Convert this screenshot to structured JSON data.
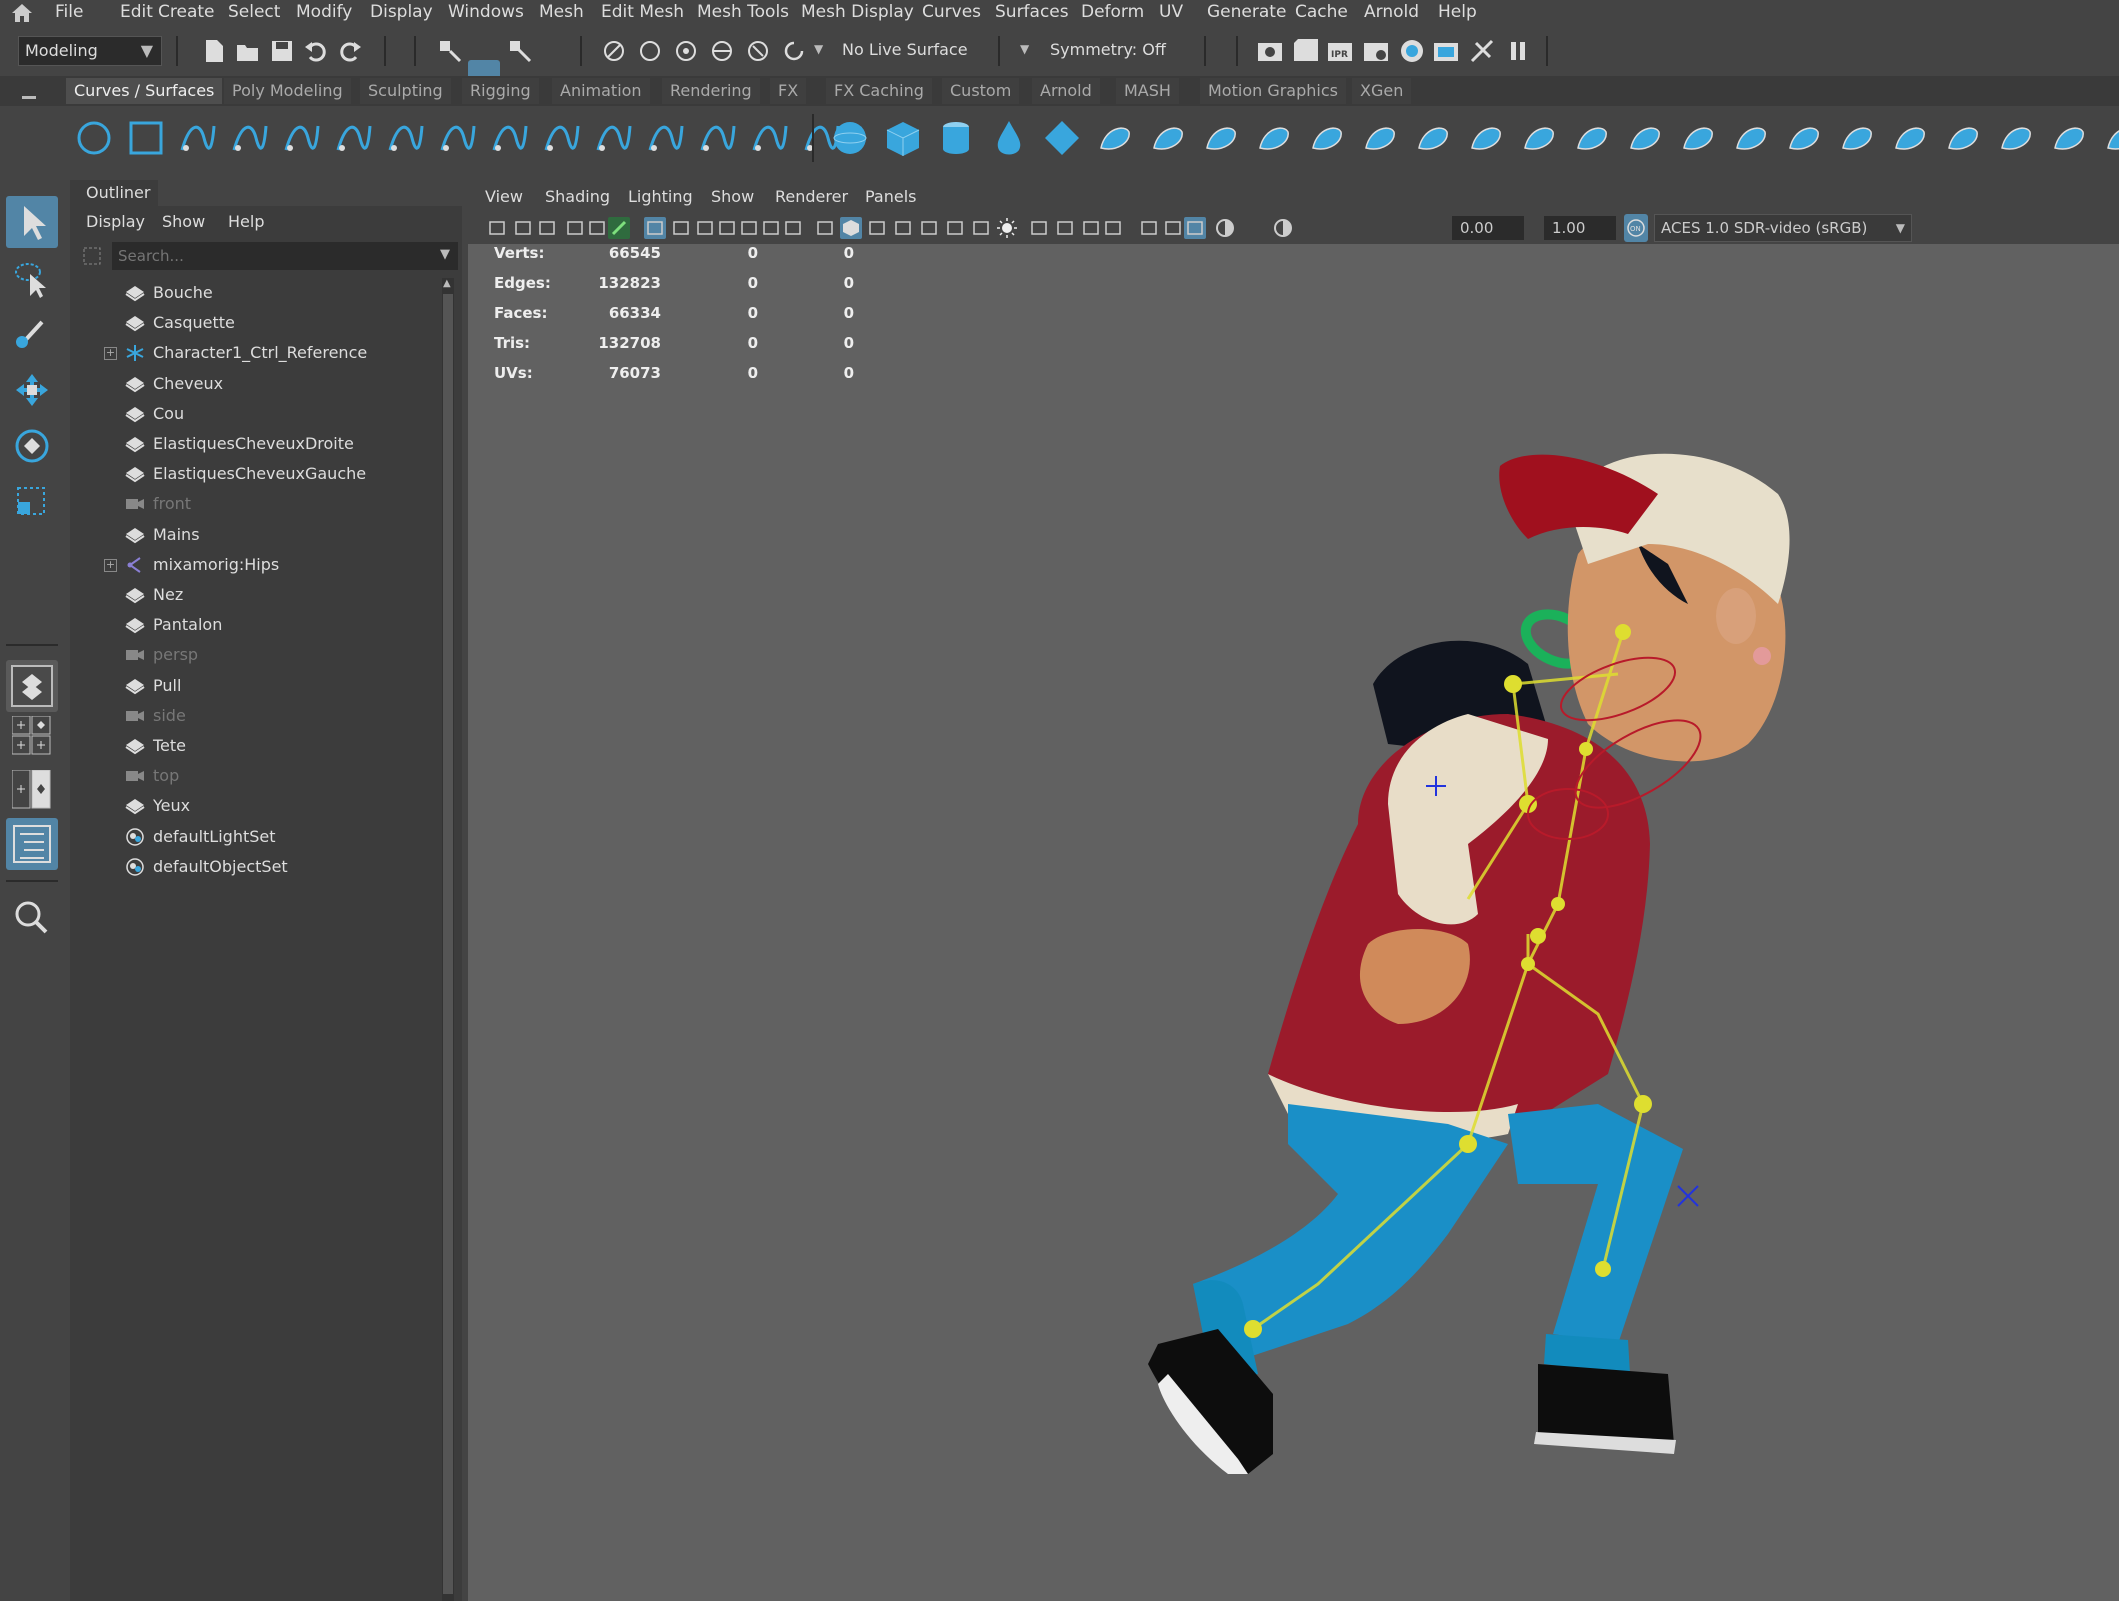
{
  "menu": [
    "File",
    "Edit",
    "Create",
    "Select",
    "Modify",
    "Display",
    "Windows",
    "Mesh",
    "Edit Mesh",
    "Mesh Tools",
    "Mesh Display",
    "Curves",
    "Surfaces",
    "Deform",
    "UV",
    "Generate",
    "Cache",
    "Arnold",
    "Help"
  ],
  "statusline": {
    "mode": "Modeling",
    "live_surface": "No Live Surface",
    "symmetry": "Symmetry: Off"
  },
  "shelf_tabs": [
    "Curves / Surfaces",
    "Poly Modeling",
    "Sculpting",
    "Rigging",
    "Animation",
    "Rendering",
    "FX",
    "FX Caching",
    "Custom",
    "Arnold",
    "MASH",
    "Motion Graphics",
    "XGen"
  ],
  "outliner": {
    "title": "Outliner",
    "menu": [
      "Display",
      "Show",
      "Help"
    ],
    "search_placeholder": "Search...",
    "items": [
      {
        "label": "Bouche",
        "icon": "mesh-icon"
      },
      {
        "label": "Casquette",
        "icon": "mesh-icon"
      },
      {
        "label": "Character1_Ctrl_Reference",
        "icon": "hik-reference-icon",
        "expandable": true
      },
      {
        "label": "Cheveux",
        "icon": "mesh-icon"
      },
      {
        "label": "Cou",
        "icon": "mesh-icon"
      },
      {
        "label": "ElastiquesCheveuxDroite",
        "icon": "mesh-icon"
      },
      {
        "label": "ElastiquesCheveuxGauche",
        "icon": "mesh-icon"
      },
      {
        "label": "front",
        "icon": "camera-icon",
        "hidden": true
      },
      {
        "label": "Mains",
        "icon": "mesh-icon"
      },
      {
        "label": "mixamorig:Hips",
        "icon": "joint-icon",
        "expandable": true
      },
      {
        "label": "Nez",
        "icon": "mesh-icon"
      },
      {
        "label": "Pantalon",
        "icon": "mesh-icon"
      },
      {
        "label": "persp",
        "icon": "camera-icon",
        "hidden": true
      },
      {
        "label": "Pull",
        "icon": "mesh-icon"
      },
      {
        "label": "side",
        "icon": "camera-icon",
        "hidden": true
      },
      {
        "label": "Tete",
        "icon": "mesh-icon"
      },
      {
        "label": "top",
        "icon": "camera-icon",
        "hidden": true
      },
      {
        "label": "Yeux",
        "icon": "mesh-icon"
      },
      {
        "label": "defaultLightSet",
        "icon": "set-icon"
      },
      {
        "label": "defaultObjectSet",
        "icon": "set-icon"
      }
    ]
  },
  "viewport": {
    "menu": [
      "View",
      "Shading",
      "Lighting",
      "Show",
      "Renderer",
      "Panels"
    ],
    "exposure": "0.00",
    "gamma": "1.00",
    "color_space": "ACES 1.0 SDR-video (sRGB)",
    "hud": [
      {
        "label": "Verts:",
        "v1": "66545",
        "v2": "0",
        "v3": "0"
      },
      {
        "label": "Edges:",
        "v1": "132823",
        "v2": "0",
        "v3": "0"
      },
      {
        "label": "Faces:",
        "v1": "66334",
        "v2": "0",
        "v3": "0"
      },
      {
        "label": "Tris:",
        "v1": "132708",
        "v2": "0",
        "v3": "0"
      },
      {
        "label": "UVs:",
        "v1": "76073",
        "v2": "0",
        "v3": "0"
      }
    ]
  },
  "colors": {
    "accent": "#5285a6",
    "shelf_icon": "#39a6dd",
    "viewport_bg": "#616161"
  }
}
